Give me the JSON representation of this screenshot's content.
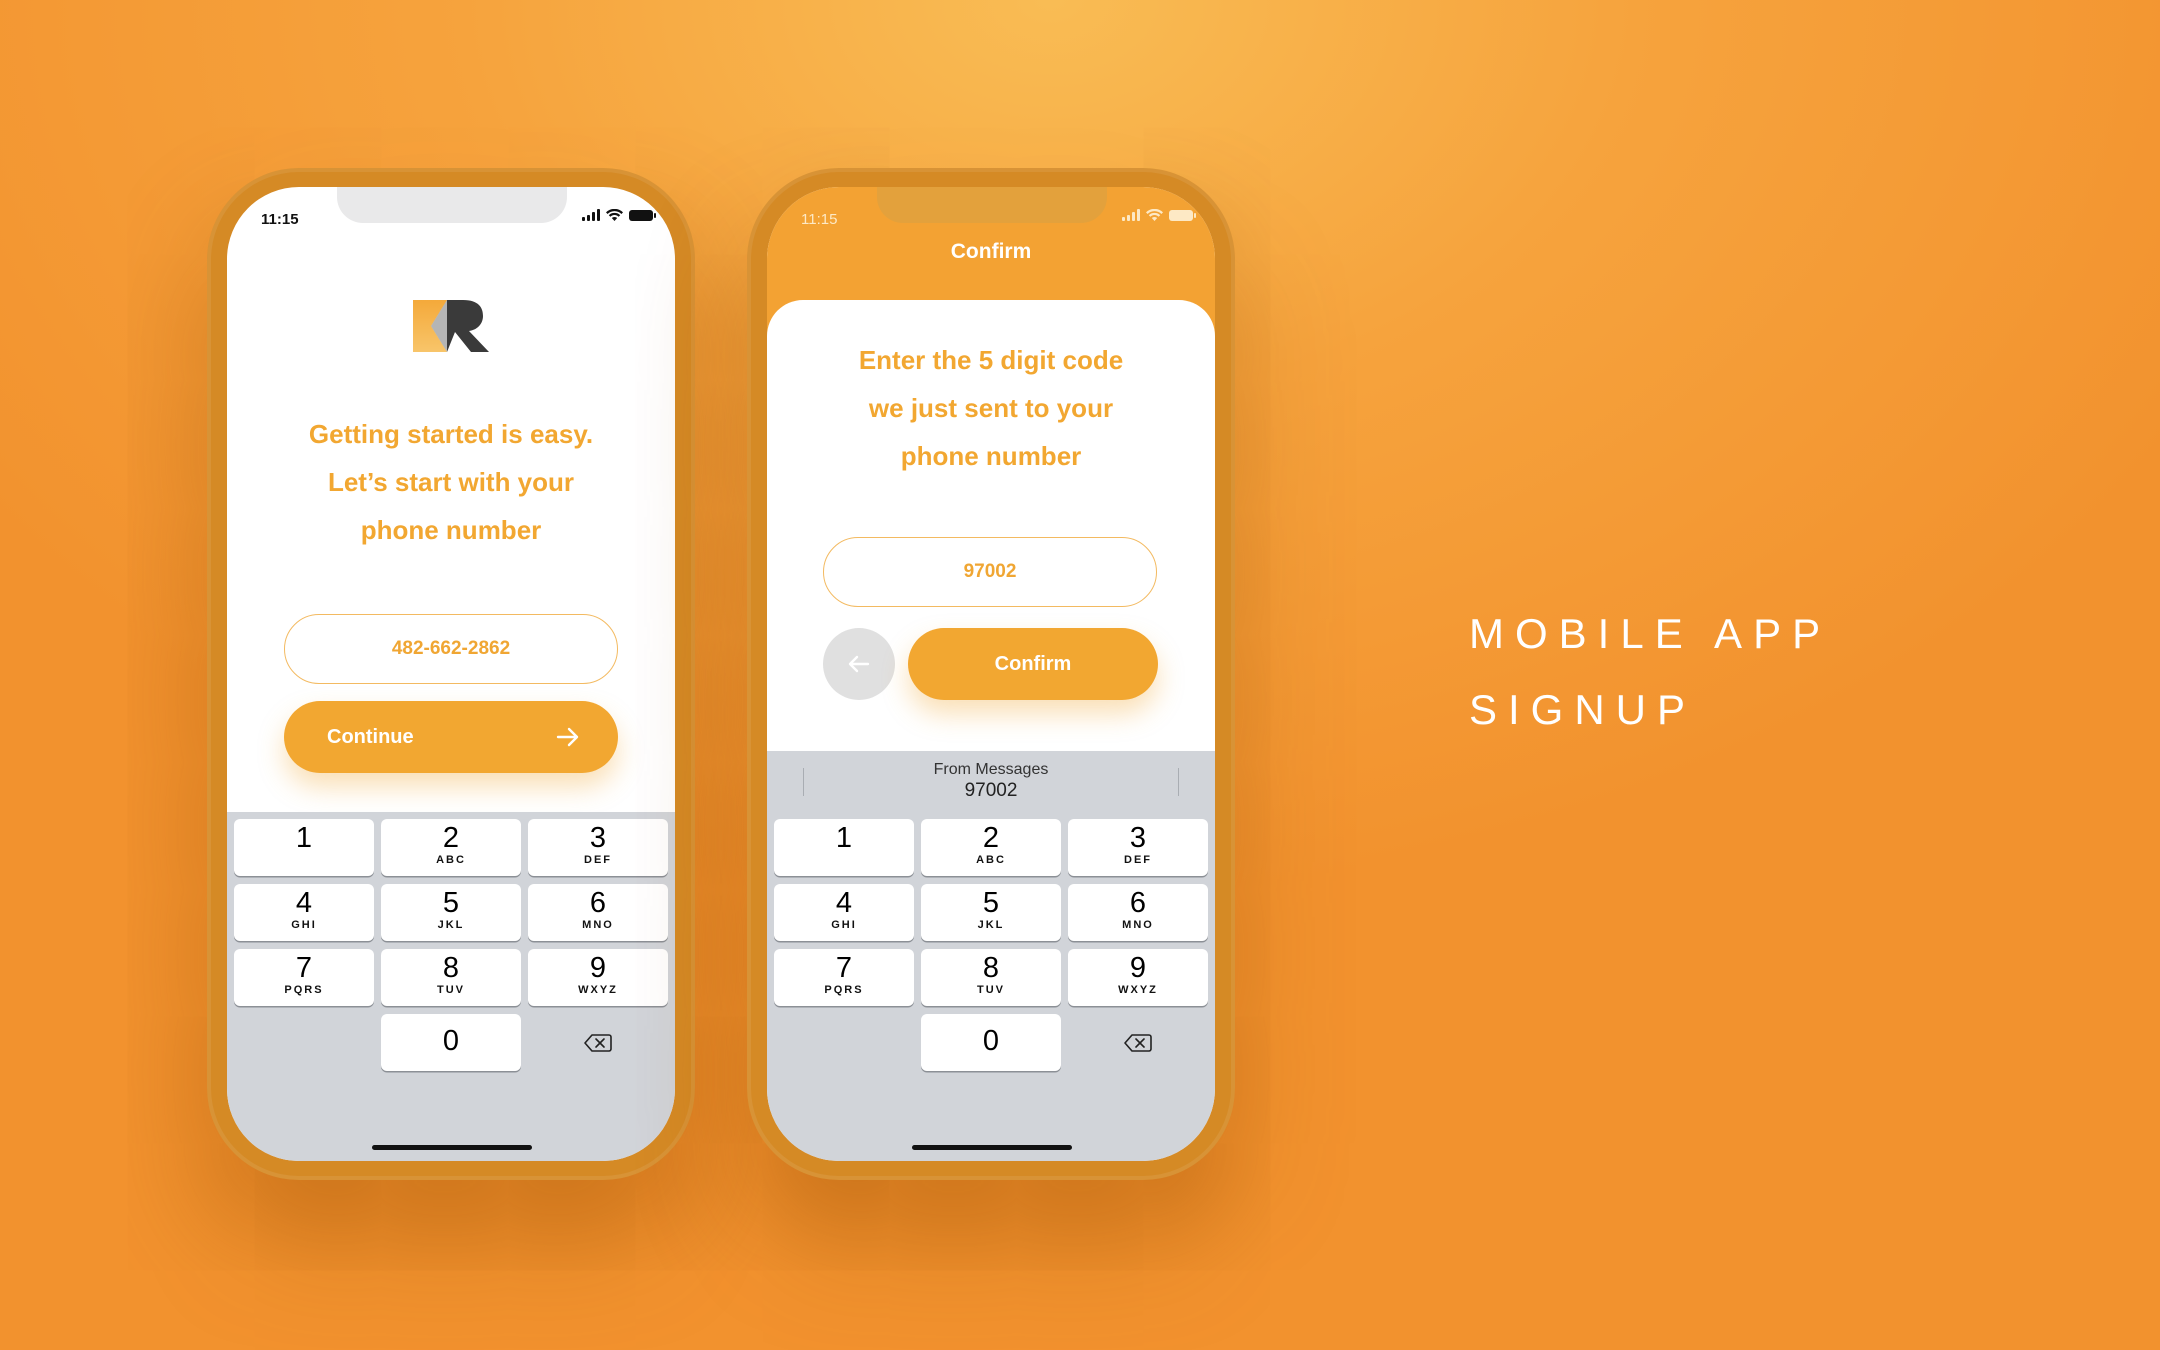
{
  "phone1": {
    "status_time": "11:15",
    "headline": [
      "Getting started is easy.",
      "Let’s start with your",
      "phone number"
    ],
    "phone_value": "482-662-2862",
    "continue_label": "Continue",
    "arrow_icon": "arrow-right-icon"
  },
  "phone2": {
    "status_time": "11:15",
    "title": "Confirm",
    "headline": [
      "Enter the 5 digit code",
      "we just sent to your",
      "phone number"
    ],
    "code_value": "97002",
    "confirm_label": "Confirm",
    "back_icon": "arrow-left-icon",
    "suggestion": {
      "source": "From Messages",
      "code": "97002"
    }
  },
  "keypad": {
    "keys": [
      {
        "num": "1",
        "letters": ""
      },
      {
        "num": "2",
        "letters": "ABC"
      },
      {
        "num": "3",
        "letters": "DEF"
      },
      {
        "num": "4",
        "letters": "GHI"
      },
      {
        "num": "5",
        "letters": "JKL"
      },
      {
        "num": "6",
        "letters": "MNO"
      },
      {
        "num": "7",
        "letters": "PQRS"
      },
      {
        "num": "8",
        "letters": "TUV"
      },
      {
        "num": "9",
        "letters": "WXYZ"
      },
      {
        "num": "0",
        "letters": ""
      }
    ],
    "delete_icon": "backspace-icon"
  },
  "side_title": [
    "MOBILE APP",
    "SIGNUP"
  ],
  "colors": {
    "accent": "#f2a731",
    "background": "#f39a33",
    "keyboard": "#d1d4d9"
  }
}
